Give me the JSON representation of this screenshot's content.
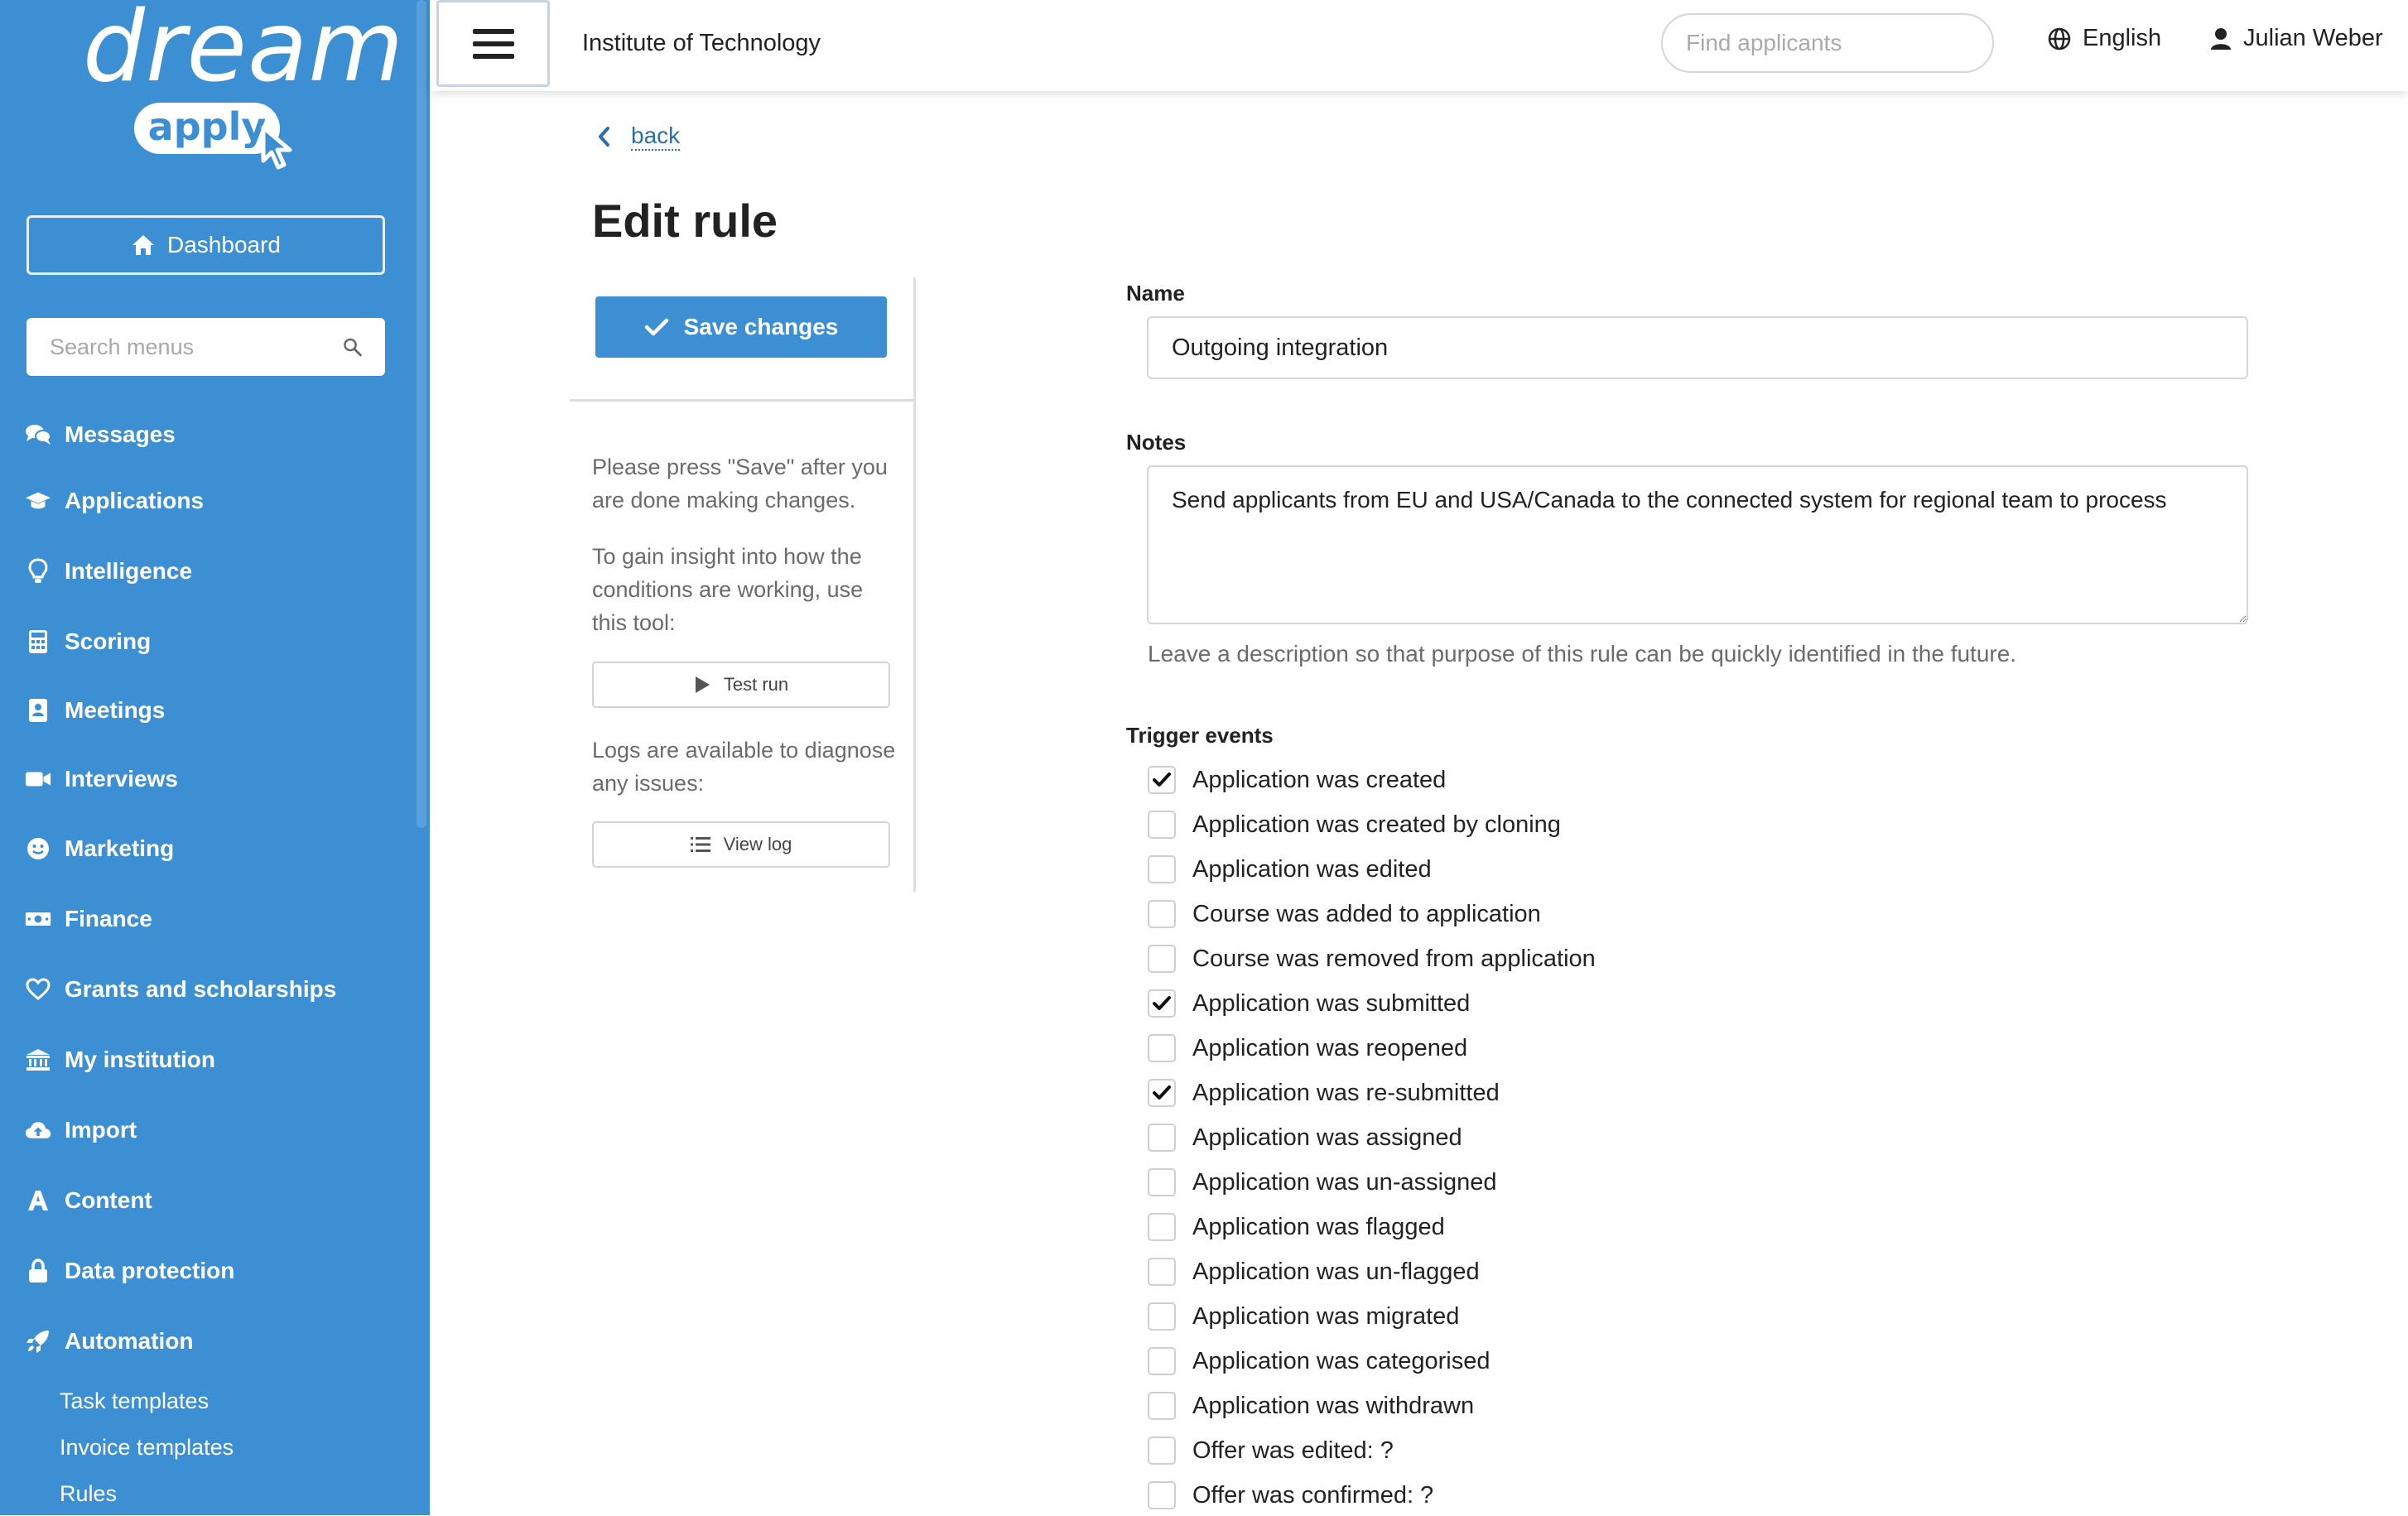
{
  "brand": {
    "logo_word": "dream",
    "logo_badge": "apply"
  },
  "sidebar": {
    "dashboard_label": "Dashboard",
    "search_placeholder": "Search menus",
    "items": [
      {
        "label": "Messages",
        "icon": "messages-icon"
      },
      {
        "label": "Applications",
        "icon": "graduation-cap-icon"
      },
      {
        "label": "Intelligence",
        "icon": "lightbulb-icon"
      },
      {
        "label": "Scoring",
        "icon": "calculator-icon"
      },
      {
        "label": "Meetings",
        "icon": "address-book-icon"
      },
      {
        "label": "Interviews",
        "icon": "video-icon"
      },
      {
        "label": "Marketing",
        "icon": "smile-icon"
      },
      {
        "label": "Finance",
        "icon": "money-bill-icon"
      },
      {
        "label": "Grants and scholarships",
        "icon": "heart-icon"
      },
      {
        "label": "My institution",
        "icon": "university-icon"
      },
      {
        "label": "Import",
        "icon": "cloud-upload-icon"
      },
      {
        "label": "Content",
        "icon": "font-icon"
      },
      {
        "label": "Data protection",
        "icon": "lock-icon"
      },
      {
        "label": "Automation",
        "icon": "rocket-icon"
      }
    ],
    "sub_items": [
      "Task templates",
      "Invoice templates",
      "Rules"
    ]
  },
  "topbar": {
    "institution": "Institute of Technology",
    "search_placeholder": "Find applicants",
    "language": "English",
    "user_name": "Julian Weber"
  },
  "page": {
    "back_label": "back",
    "title": "Edit rule",
    "save_label": "Save changes",
    "help_save": "Please press \"Save\" after you are done making changes.",
    "help_insight": "To gain insight into how the conditions are working, use this tool:",
    "test_run_label": "Test run",
    "help_logs": "Logs are available to diagnose any issues:",
    "view_log_label": "View log"
  },
  "form": {
    "name_label": "Name",
    "name_value": "Outgoing integration",
    "notes_label": "Notes",
    "notes_value": "Send applicants from EU and USA/Canada to the connected system for regional team to process",
    "notes_help": "Leave a description so that purpose of this rule can be quickly identified in the future.",
    "trigger_label": "Trigger events",
    "triggers": [
      {
        "label": "Application was created",
        "checked": true
      },
      {
        "label": "Application was created by cloning",
        "checked": false
      },
      {
        "label": "Application was edited",
        "checked": false
      },
      {
        "label": "Course was added to application",
        "checked": false
      },
      {
        "label": "Course was removed from application",
        "checked": false
      },
      {
        "label": "Application was submitted",
        "checked": true
      },
      {
        "label": "Application was reopened",
        "checked": false
      },
      {
        "label": "Application was re-submitted",
        "checked": true
      },
      {
        "label": "Application was assigned",
        "checked": false
      },
      {
        "label": "Application was un-assigned",
        "checked": false
      },
      {
        "label": "Application was flagged",
        "checked": false
      },
      {
        "label": "Application was un-flagged",
        "checked": false
      },
      {
        "label": "Application was migrated",
        "checked": false
      },
      {
        "label": "Application was categorised",
        "checked": false
      },
      {
        "label": "Application was withdrawn",
        "checked": false
      },
      {
        "label": "Offer was edited: ?",
        "checked": false
      },
      {
        "label": "Offer was confirmed: ?",
        "checked": false
      }
    ]
  },
  "colors": {
    "sidebar_bg": "#3d8fd4",
    "accent": "#3d8fd4",
    "link": "#2a6fa8"
  }
}
